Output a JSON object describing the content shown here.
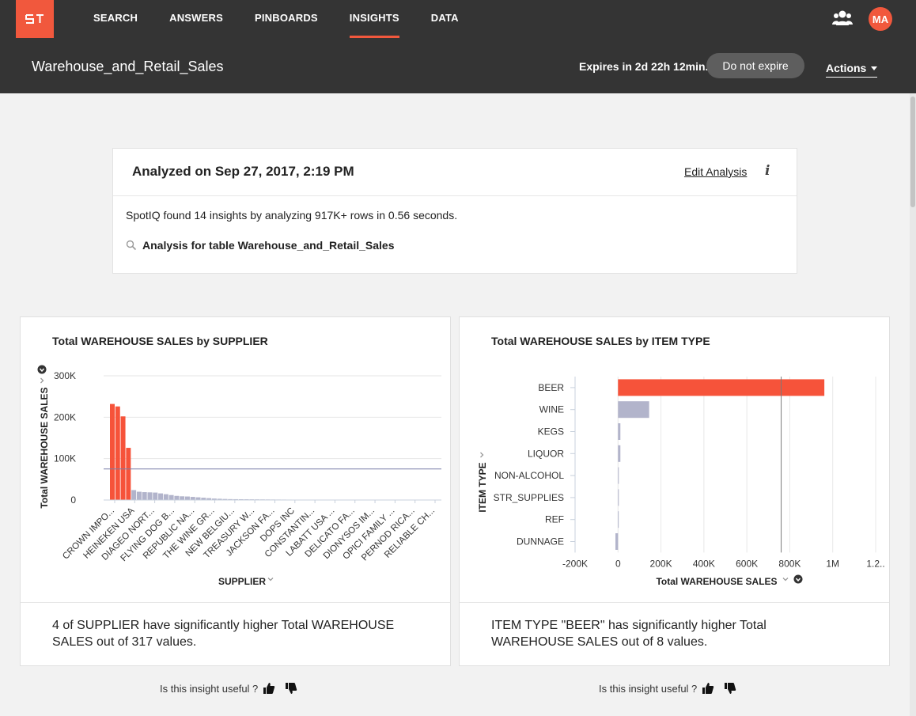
{
  "nav": {
    "items": [
      "SEARCH",
      "ANSWERS",
      "PINBOARDS",
      "INSIGHTS",
      "DATA"
    ],
    "active_index": 3,
    "avatar_initials": "MA"
  },
  "header": {
    "title": "Warehouse_and_Retail_Sales",
    "expires": "Expires in 2d 22h 12min.",
    "no_expire_label": "Do not expire",
    "actions_label": "Actions"
  },
  "summary": {
    "analyzed": "Analyzed on Sep 27, 2017, 2:19 PM",
    "edit_label": "Edit Analysis",
    "found_text": "SpotIQ found 14 insights by analyzing 917K+ rows in 0.56 seconds.",
    "analysis_label": "Analysis for table Warehouse_and_Retail_Sales"
  },
  "colors": {
    "accent": "#f1583d",
    "highlight_bar": "#f6533a",
    "normal_bar": "#b2b4cb",
    "topbar": "#343434"
  },
  "cards": [
    {
      "title": "Total WAREHOUSE SALES by SUPPLIER",
      "insight": "4 of SUPPLIER have significantly higher Total WAREHOUSE SALES out of 317 values.",
      "feedback": "Is this insight useful ?"
    },
    {
      "title": "Total WAREHOUSE SALES by ITEM TYPE",
      "insight": "ITEM TYPE \"BEER\" has significantly higher Total WAREHOUSE SALES out of 8 values.",
      "feedback": "Is this insight useful ?"
    }
  ],
  "chart_data": [
    {
      "type": "bar",
      "title": "Total WAREHOUSE SALES by SUPPLIER",
      "xlabel": "SUPPLIER",
      "ylabel": "Total WAREHOUSE SALES",
      "ylim": [
        0,
        300000
      ],
      "yticks": [
        "0",
        "100K",
        "200K",
        "300K"
      ],
      "reference_line": 75000,
      "tick_labels": [
        "CROWN IMPO...",
        "HEINEKEN USA",
        "DIAGEO NORT...",
        "FLYING DOG B...",
        "REPUBLIC NA...",
        "THE WINE GR...",
        "NEW BELGIU...",
        "TREASURY W...",
        "JACKSON FA...",
        "DOPS INC",
        "CONSTANTIN...",
        "LABATT USA ...",
        "DELICATO FA...",
        "DIONYSOS IM...",
        "OPICI FAMILY ...",
        "PERNOD RICA...",
        "RELIABLE CH..."
      ],
      "values": [
        232000,
        226000,
        202000,
        126000,
        24000,
        20000,
        19000,
        18500,
        18000,
        16000,
        14000,
        12000,
        10000,
        9000,
        8500,
        7500,
        6500,
        5500,
        4500,
        3500,
        3000,
        2500,
        2200,
        2000,
        1900,
        1800,
        1700,
        1600,
        1500,
        1400,
        1300,
        1200,
        1100,
        1000,
        900,
        800,
        700,
        650,
        600,
        550,
        500,
        480,
        460,
        440,
        420,
        400,
        380,
        360,
        340,
        320,
        300,
        280,
        260,
        240,
        220,
        200,
        180,
        160,
        140,
        120
      ],
      "highlight_count": 4
    },
    {
      "type": "bar",
      "orientation": "horizontal",
      "title": "Total WAREHOUSE SALES by ITEM TYPE",
      "xlabel": "Total WAREHOUSE SALES",
      "ylabel": "ITEM TYPE",
      "xlim": [
        -200000,
        1200000
      ],
      "xticks": [
        "-200K",
        "0",
        "200K",
        "400K",
        "600K",
        "800K",
        "1M",
        "1.2.."
      ],
      "categories": [
        "BEER",
        "WINE",
        "KEGS",
        "LIQUOR",
        "NON-ALCOHOL",
        "STR_SUPPLIES",
        "REF",
        "DUNNAGE"
      ],
      "values": [
        961000,
        145000,
        11000,
        11000,
        1000,
        800,
        -500,
        -12000
      ],
      "reference_line": 760000,
      "highlight": [
        "BEER"
      ]
    }
  ]
}
